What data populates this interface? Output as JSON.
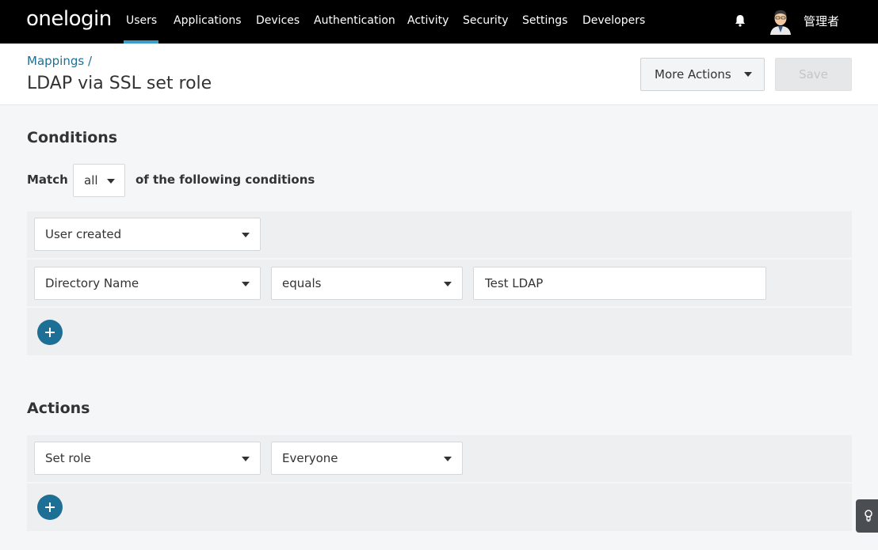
{
  "nav": {
    "logo": "onelogin",
    "items": [
      "Users",
      "Applications",
      "Devices",
      "Authentication",
      "Activity",
      "Security",
      "Settings",
      "Developers"
    ],
    "active_index": 0,
    "username": "管理者"
  },
  "header": {
    "breadcrumb": "Mappings /",
    "title": "LDAP via SSL set role",
    "more_actions_label": "More Actions",
    "save_label": "Save"
  },
  "conditions": {
    "title": "Conditions",
    "match_label": "Match",
    "match_value": "all",
    "match_suffix": "of the following conditions",
    "rows": [
      {
        "field": "User created"
      },
      {
        "field": "Directory Name",
        "operator": "equals",
        "value": "Test LDAP"
      }
    ]
  },
  "actions": {
    "title": "Actions",
    "rows": [
      {
        "action": "Set role",
        "value": "Everyone"
      }
    ]
  },
  "colors": {
    "accent": "#1e6f95",
    "nav_bg": "#000000",
    "active_indicator": "#3d9ec7"
  }
}
